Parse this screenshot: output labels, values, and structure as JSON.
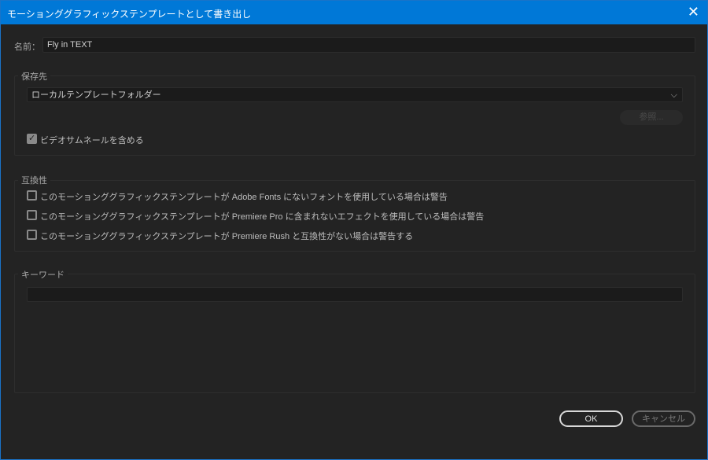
{
  "window": {
    "title": "モーションググラフィックステンプレートとして書き出し"
  },
  "name": {
    "label": "名前：",
    "value": "Fly in TEXT"
  },
  "destination": {
    "label": "保存先",
    "selected": "ローカルテンプレートフォルダー",
    "browse": "参照...",
    "thumbnail_label": "ビデオサムネールを含める",
    "thumbnail_checked": true
  },
  "compatibility": {
    "label": "互換性",
    "items": [
      "このモーションググラフィックステンプレートが Adobe Fonts にないフォントを使用している場合は警告",
      "このモーションググラフィックステンプレートが Premiere Pro に含まれないエフェクトを使用している場合は警告",
      "このモーションググラフィックステンプレートが Premiere Rush と互換性がない場合は警告する"
    ]
  },
  "keywords": {
    "label": "キーワード",
    "value": ""
  },
  "buttons": {
    "ok": "OK",
    "cancel": "キャンセル"
  }
}
